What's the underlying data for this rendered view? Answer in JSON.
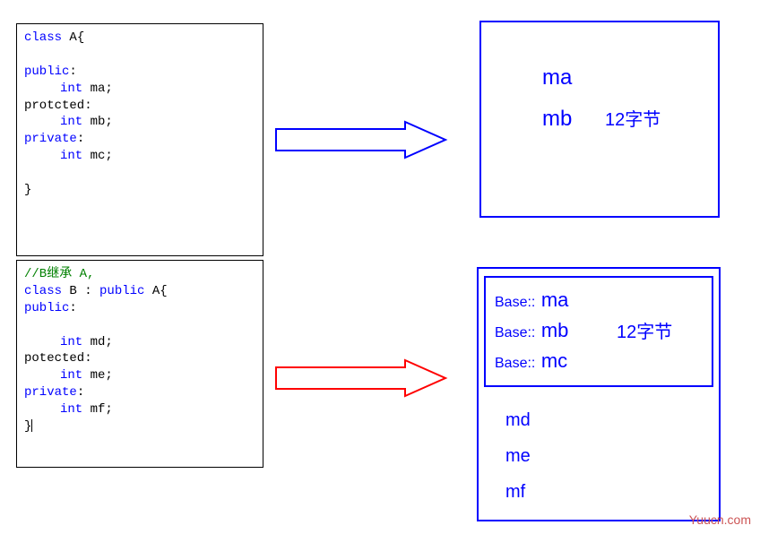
{
  "codeA": {
    "l1a": "class",
    "l1b": "  A{",
    "l2": "public",
    "l3a": "int",
    "l3b": " ma;",
    "l4": "protcted:",
    "l5a": "int",
    "l5b": " mb;",
    "l6": "private",
    "l7a": "int",
    "l7b": " mc;",
    "l8": "}"
  },
  "codeB": {
    "c1": "//B继承 A,",
    "l1a": "class",
    "l1b": " B : ",
    "l1c": "public",
    "l1d": " A{",
    "l2": "public",
    "l3a": "int",
    "l3b": " md;",
    "l4": "potected:",
    "l5a": "int",
    "l5b": " me;",
    "l6": "private",
    "l7a": "int",
    "l7b": " mf;",
    "l8": "}"
  },
  "memA": {
    "ma": "ma",
    "mb": "mb",
    "size": "12字节"
  },
  "memB": {
    "base": "Base::",
    "ma": "ma",
    "mb": "mb",
    "mc": "mc",
    "size": "12字节",
    "md": "md",
    "me": "me",
    "mf": "mf"
  },
  "footer": "Yuucn.com"
}
